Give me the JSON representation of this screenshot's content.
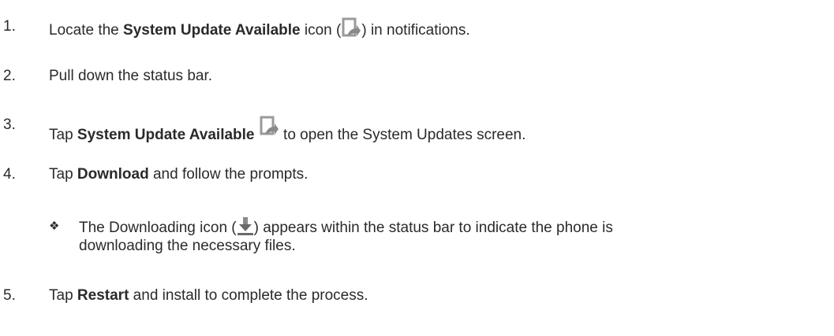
{
  "steps": [
    {
      "num": "1.",
      "pre": "Locate the ",
      "bold": "System Update Available",
      "mid": " icon (",
      "icon": "system-update-icon",
      "post": ") in notifications."
    },
    {
      "num": "2.",
      "text": "Pull down the status bar."
    },
    {
      "num": "3.",
      "pre": "Tap ",
      "bold": "System Update Available",
      "icon": "system-update-icon",
      "post": " to open the System Updates screen."
    },
    {
      "num": "4.",
      "pre": "Tap ",
      "bold": "Download",
      "post": " and follow the prompts."
    },
    {
      "num": "5.",
      "pre": "Tap ",
      "bold": "Restart",
      "post": " and install to complete the process."
    }
  ],
  "note": {
    "bullet": "❖",
    "line1_pre": "The Downloading icon (",
    "icon": "download-icon",
    "line1_post": ") appears within the status bar to indicate the phone is",
    "line2": "downloading the necessary files."
  }
}
